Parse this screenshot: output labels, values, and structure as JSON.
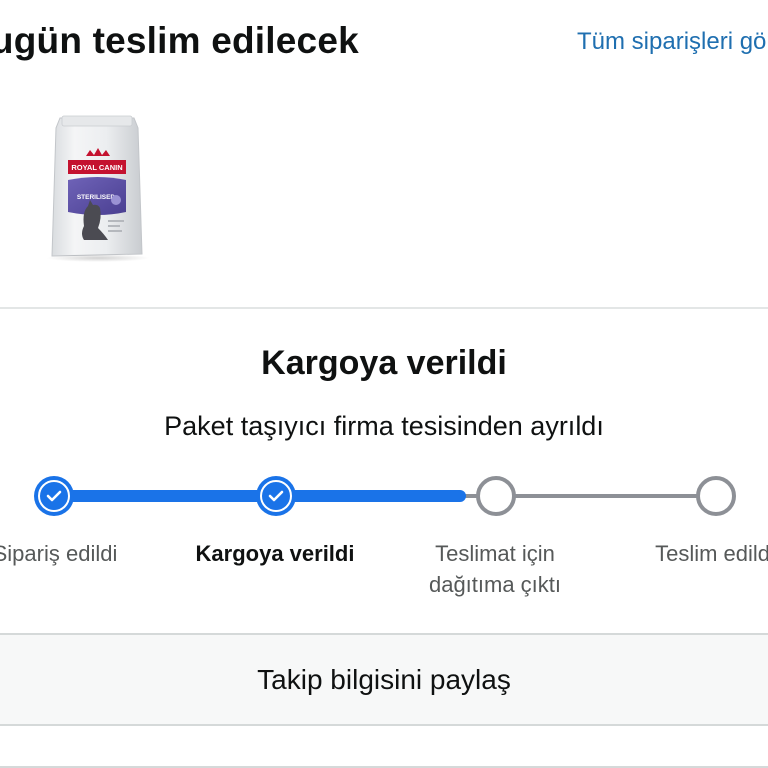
{
  "header": {
    "title": "Bugün teslim edilecek",
    "all_orders_link": "Tüm siparişleri görüntüle"
  },
  "product": {
    "image_icon": "cat-food-bag-icon",
    "brand_text": "ROYAL CANIN",
    "variant_text": "STERILISED"
  },
  "shipment": {
    "status_title": "Kargoya verildi",
    "status_detail": "Paket taşıyıcı firma tesisinden ayrıldı",
    "progress_fraction": 0.62,
    "steps": [
      {
        "label": "Sipariş edildi",
        "line2": "",
        "state": "done"
      },
      {
        "label": "Kargoya verildi",
        "line2": "",
        "state": "current"
      },
      {
        "label": "Teslimat için",
        "line2": "dağıtıma çıktı",
        "state": "pending"
      },
      {
        "label": "Teslim edildi",
        "line2": "",
        "state": "pending"
      }
    ]
  },
  "actions": {
    "share_tracking": "Takip bilgisini paylaş"
  },
  "colors": {
    "accent_blue": "#1a73e8",
    "link_blue": "#1f6fb0",
    "pending_gray": "#8d9096",
    "text_dark": "#0f1111"
  }
}
